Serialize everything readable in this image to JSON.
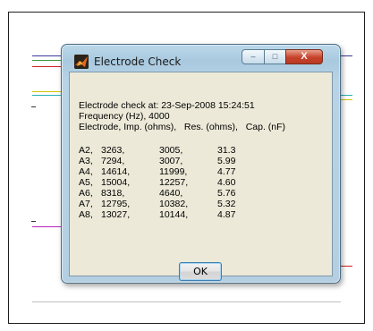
{
  "window": {
    "title": "Electrode Check",
    "caption_buttons": {
      "minimize": "–",
      "maximize": "□",
      "close": "X"
    }
  },
  "message": {
    "check_line": "Electrode check at: 23-Sep-2008 15:24:51",
    "frequency_line": "Frequency (Hz), 4000",
    "header_line": "Electrode, Imp. (ohms),   Res. (ohms),   Cap. (nF)"
  },
  "rows": [
    {
      "electrode": "A2,",
      "imp": "3263,",
      "res": "3005,",
      "cap": "31.3"
    },
    {
      "electrode": "A3,",
      "imp": "7294,",
      "res": "3007,",
      "cap": "5.99"
    },
    {
      "electrode": "A4,",
      "imp": "14614,",
      "res": "11999,",
      "cap": "4.77"
    },
    {
      "electrode": "A5,",
      "imp": "15004,",
      "res": "12257,",
      "cap": "4.60"
    },
    {
      "electrode": "A6,",
      "imp": "8318,",
      "res": "4640,",
      "cap": "5.76"
    },
    {
      "electrode": "A7,",
      "imp": "12795,",
      "res": "10382,",
      "cap": "5.32"
    },
    {
      "electrode": "A8,",
      "imp": "13027,",
      "res": "10144,",
      "cap": "4.87"
    }
  ],
  "ok_label": "OK",
  "trace_colors": [
    "#3a3a9a",
    "#3a9a3a",
    "#cc2222",
    "#d4c400",
    "#22b2b2",
    "#bb22bb",
    "#cc2222"
  ]
}
